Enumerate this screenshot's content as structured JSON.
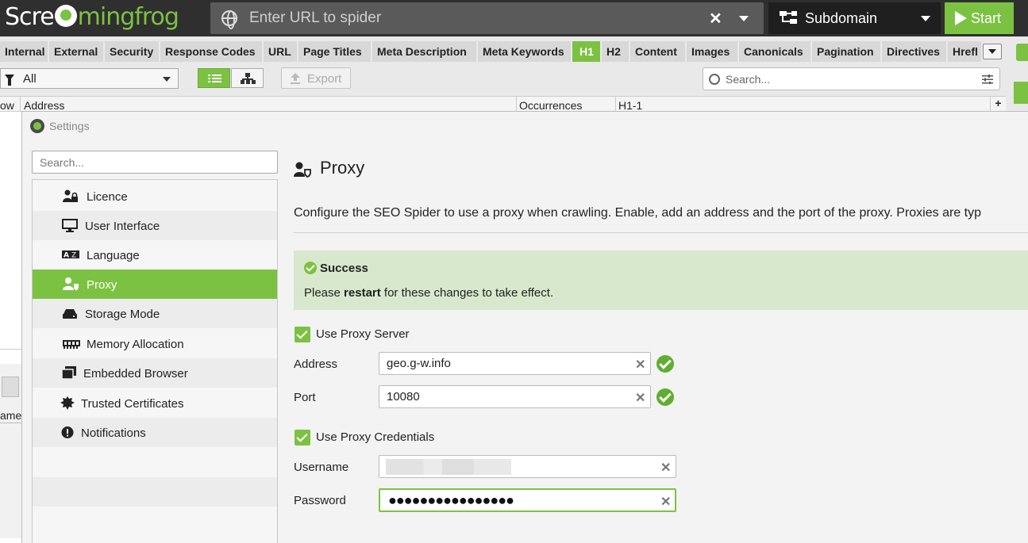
{
  "app": {
    "logo_left": "Scre",
    "logo_right": "mingfrog",
    "url_placeholder": "Enter URL to spider",
    "mode": "Subdomain",
    "start_label": "Start"
  },
  "tabs": [
    {
      "label": "Internal",
      "active": false
    },
    {
      "label": "External",
      "active": false
    },
    {
      "label": "Security",
      "active": false
    },
    {
      "label": "Response Codes",
      "active": false
    },
    {
      "label": "URL",
      "active": false
    },
    {
      "label": "Page Titles",
      "active": false
    },
    {
      "label": "Meta Description",
      "active": false
    },
    {
      "label": "Meta Keywords",
      "active": false
    },
    {
      "label": "H1",
      "active": true
    },
    {
      "label": "H2",
      "active": false
    },
    {
      "label": "Content",
      "active": false
    },
    {
      "label": "Images",
      "active": false
    },
    {
      "label": "Canonicals",
      "active": false
    },
    {
      "label": "Pagination",
      "active": false
    },
    {
      "label": "Directives",
      "active": false
    },
    {
      "label": "Hrefl",
      "active": false
    }
  ],
  "toolbar": {
    "filter_value": "All",
    "export_label": "Export",
    "search_placeholder": "Search..."
  },
  "table": {
    "col_row": "ow",
    "col_address": "Address",
    "col_occurrences": "Occurrences",
    "col_h1": "H1-1",
    "bottom_cut_label": "ame"
  },
  "settings": {
    "title": "Settings",
    "search_placeholder": "Search...",
    "nav": [
      {
        "label": "Licence",
        "icon": "licence-icon",
        "glyph": "🔒"
      },
      {
        "label": "User Interface",
        "icon": "monitor-icon",
        "glyph": "🖵"
      },
      {
        "label": "Language",
        "icon": "language-icon",
        "glyph": "A"
      },
      {
        "label": "Proxy",
        "icon": "proxy-icon",
        "glyph": "👤"
      },
      {
        "label": "Storage Mode",
        "icon": "storage-icon",
        "glyph": "▬"
      },
      {
        "label": "Memory Allocation",
        "icon": "memory-icon",
        "glyph": "▦"
      },
      {
        "label": "Embedded Browser",
        "icon": "browser-icon",
        "glyph": "❐"
      },
      {
        "label": "Trusted Certificates",
        "icon": "certificate-icon",
        "glyph": "✹"
      },
      {
        "label": "Notifications",
        "icon": "notification-icon",
        "glyph": "!"
      }
    ],
    "active_nav": "Proxy"
  },
  "proxy": {
    "heading": "Proxy",
    "description": "Configure the SEO Spider to use a proxy when crawling. Enable, add an address and the port of the proxy. Proxies are typ",
    "success_title": "Success",
    "success_msg_before": "Please ",
    "success_msg_bold": "restart",
    "success_msg_after": " for these changes to take effect.",
    "use_proxy_label": "Use Proxy Server",
    "address_label": "Address",
    "address_value": "geo.g-w.info",
    "port_label": "Port",
    "port_value": "10080",
    "use_credentials_label": "Use Proxy Credentials",
    "username_label": "Username",
    "password_label": "Password",
    "password_mask": "●●●●●●●●●●●●●●●●"
  },
  "colors": {
    "accent": "#7cc242",
    "topbar": "#2f2f2f",
    "success_bg": "#d8e8cc"
  }
}
